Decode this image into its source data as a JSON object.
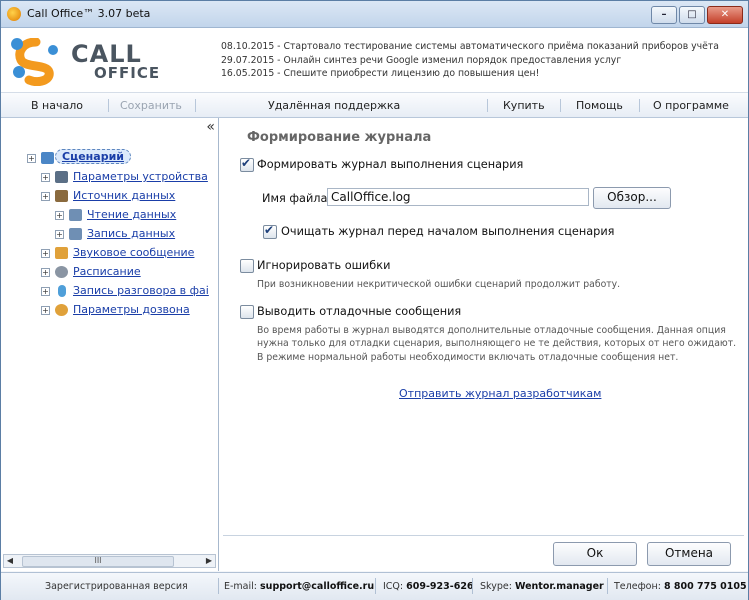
{
  "window": {
    "title": "Call Office™ 3.07 beta",
    "controls": {
      "minimize": "–",
      "maximize": "□",
      "close": "✕"
    }
  },
  "logo": {
    "line1": "CALL",
    "line2": "OFFICE"
  },
  "news": [
    "08.10.2015 - Стартовало тестирование системы автоматического приёма показаний приборов учёта",
    "29.07.2015 - Онлайн синтез речи Google изменил порядок предоставления услуг",
    "16.05.2015 - Спешите приобрести лицензию до повышения цен!"
  ],
  "toolbar": {
    "home": "В начало",
    "save": "Сохранить",
    "remote": "Удалённая поддержка",
    "buy": "Купить",
    "help": "Помощь",
    "about": "О программе"
  },
  "sidebar": {
    "collapse": "«",
    "items": [
      {
        "label": "Сценарий",
        "icon": "scenario-icon",
        "color": "#4b86c6"
      },
      {
        "label": "Параметры устройства",
        "icon": "device-icon",
        "color": "#5b6f86"
      },
      {
        "label": "Источник данных",
        "icon": "database-icon",
        "color": "#8a6a3e"
      },
      {
        "label": "Чтение данных",
        "icon": "read-data-icon",
        "color": "#6f8fb4"
      },
      {
        "label": "Запись данных",
        "icon": "write-data-icon",
        "color": "#6f8fb4"
      },
      {
        "label": "Звуковое сообщение",
        "icon": "speaker-icon",
        "color": "#e0a13a"
      },
      {
        "label": "Расписание",
        "icon": "clock-icon",
        "color": "#8a95a3"
      },
      {
        "label": "Запись разговора в фаі",
        "icon": "microphone-icon",
        "color": "#4f9fd9"
      },
      {
        "label": "Параметры дозвона",
        "icon": "settings-icon",
        "color": "#e0a13a"
      }
    ],
    "scroll_thumb": "III"
  },
  "main": {
    "title": "Формирование журнала",
    "log_enable": {
      "label": "Формировать журнал выполнения сценария",
      "checked": true
    },
    "filename_label": "Имя файла:",
    "filename_value": "CallOffice.log",
    "browse": "Обзор...",
    "clear_log": {
      "label": "Очищать журнал перед началом выполнения сценария",
      "checked": true
    },
    "ignore_errors": {
      "label": "Игнорировать ошибки",
      "checked": false
    },
    "ignore_hint": "При возникновении некритической ошибки сценарий продолжит работу.",
    "debug": {
      "label": "Выводить отладочные сообщения",
      "checked": false
    },
    "debug_hint": [
      "Во время работы в журнал выводятся дополнительные отладочные сообщения. Данная опция",
      "нужна только для отладки сценария, выполняющего не те действия, которых от него ожидают.",
      "В режиме нормальной работы необходимости включать отладочные сообщения нет."
    ],
    "send_link": "Отправить журнал разработчикам",
    "ok": "Ок",
    "cancel": "Отмена"
  },
  "status": {
    "registered": "Зарегистрированная версия",
    "email_label": "E-mail:",
    "email": "support@calloffice.ru",
    "icq_label": "ICQ:",
    "icq": "609-923-626",
    "skype_label": "Skype:",
    "skype": "Wentor.manager",
    "phone_label": "Телефон:",
    "phone": "8 800 775 0105"
  }
}
